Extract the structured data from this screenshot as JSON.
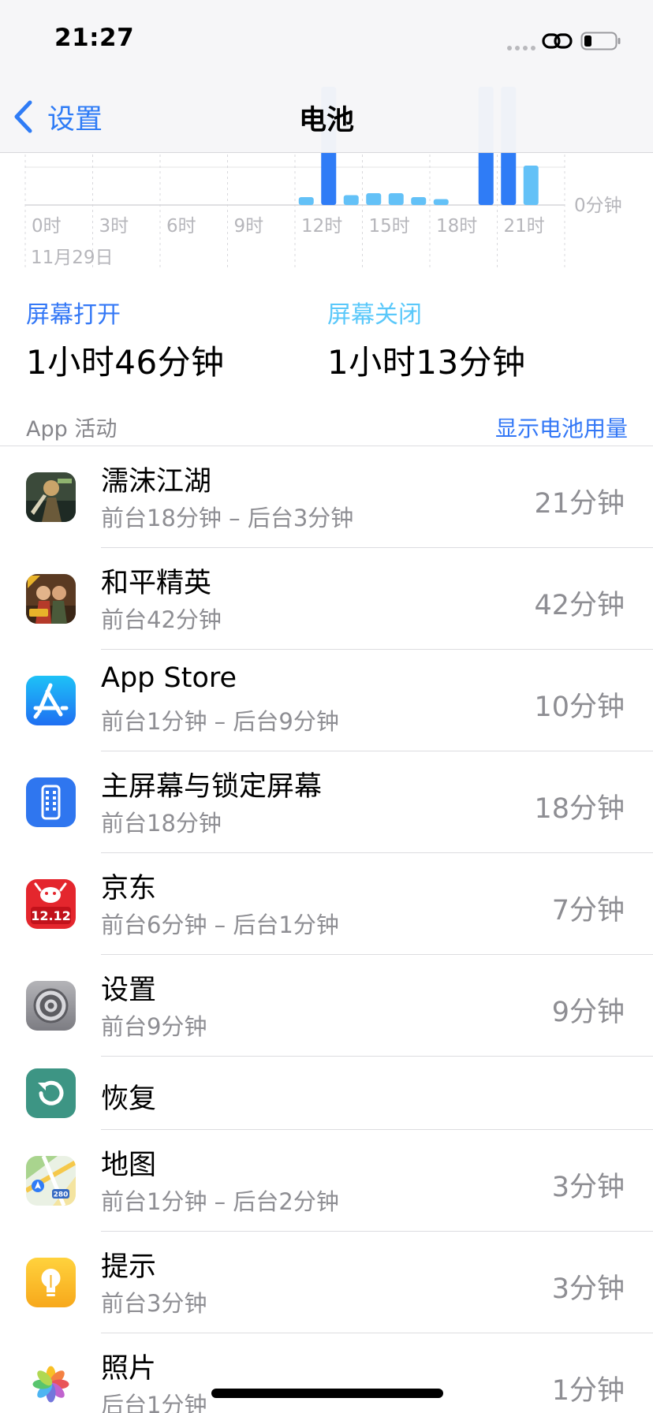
{
  "status_bar": {
    "time": "21:27"
  },
  "nav": {
    "back_label": "设置",
    "title": "电池"
  },
  "chart_data": {
    "type": "bar",
    "categories": [
      "0时",
      "1时",
      "2时",
      "3时",
      "4时",
      "5时",
      "6时",
      "7时",
      "8时",
      "9时",
      "10时",
      "11时",
      "12时",
      "13时",
      "14时",
      "15时",
      "16时",
      "17时",
      "18时",
      "19时",
      "20时",
      "21时",
      "22时",
      "23时"
    ],
    "series": [
      {
        "values": [
          0,
          0,
          0,
          0,
          0,
          0,
          0,
          0,
          0,
          0,
          0,
          0,
          0,
          60,
          0,
          0,
          0,
          0,
          0,
          0,
          60,
          60,
          0,
          0
        ],
        "color": "#2f7cf6"
      },
      {
        "values": [
          0,
          0,
          0,
          0,
          0,
          0,
          0,
          0,
          0,
          0,
          0,
          0,
          4,
          0,
          5,
          6,
          6,
          4,
          3,
          0,
          0,
          0,
          20,
          0
        ],
        "color": "#63c1f7"
      }
    ],
    "x_ticks": [
      "0时",
      "3时",
      "6时",
      "9时",
      "12时",
      "15时",
      "18时",
      "21时"
    ],
    "date_label": "11月29日",
    "y_baseline_label": "0分钟"
  },
  "screen": {
    "on_label": "屏幕打开",
    "on_value": "1小时46分钟",
    "off_label": "屏幕关闭",
    "off_value": "1小时13分钟"
  },
  "section": {
    "title": "App 活动",
    "action": "显示电池用量"
  },
  "apps": [
    {
      "name": "濡沫江湖",
      "detail": "前台18分钟 – 后台3分钟",
      "time": "21分钟",
      "icon": "game-wuxia-icon"
    },
    {
      "name": "和平精英",
      "detail": "前台42分钟",
      "time": "42分钟",
      "icon": "game-peace-elite-icon"
    },
    {
      "name": "App Store",
      "detail": "前台1分钟 – 后台9分钟",
      "time": "10分钟",
      "icon": "app-store-icon"
    },
    {
      "name": "主屏幕与锁定屏幕",
      "detail": "前台18分钟",
      "time": "18分钟",
      "icon": "home-lock-screen-icon"
    },
    {
      "name": "京东",
      "detail": "前台6分钟 – 后台1分钟",
      "time": "7分钟",
      "icon": "jd-icon",
      "icon_text": "12.12"
    },
    {
      "name": "设置",
      "detail": "前台9分钟",
      "time": "9分钟",
      "icon": "settings-gear-icon"
    },
    {
      "name": "恢复",
      "detail": "",
      "time": "",
      "icon": "restore-icon"
    },
    {
      "name": "地图",
      "detail": "前台1分钟 – 后台2分钟",
      "time": "3分钟",
      "icon": "maps-icon",
      "icon_text": "280"
    },
    {
      "name": "提示",
      "detail": "前台3分钟",
      "time": "3分钟",
      "icon": "tips-icon"
    },
    {
      "name": "照片",
      "detail": "后台1分钟",
      "time": "1分钟",
      "icon": "photos-icon"
    }
  ]
}
